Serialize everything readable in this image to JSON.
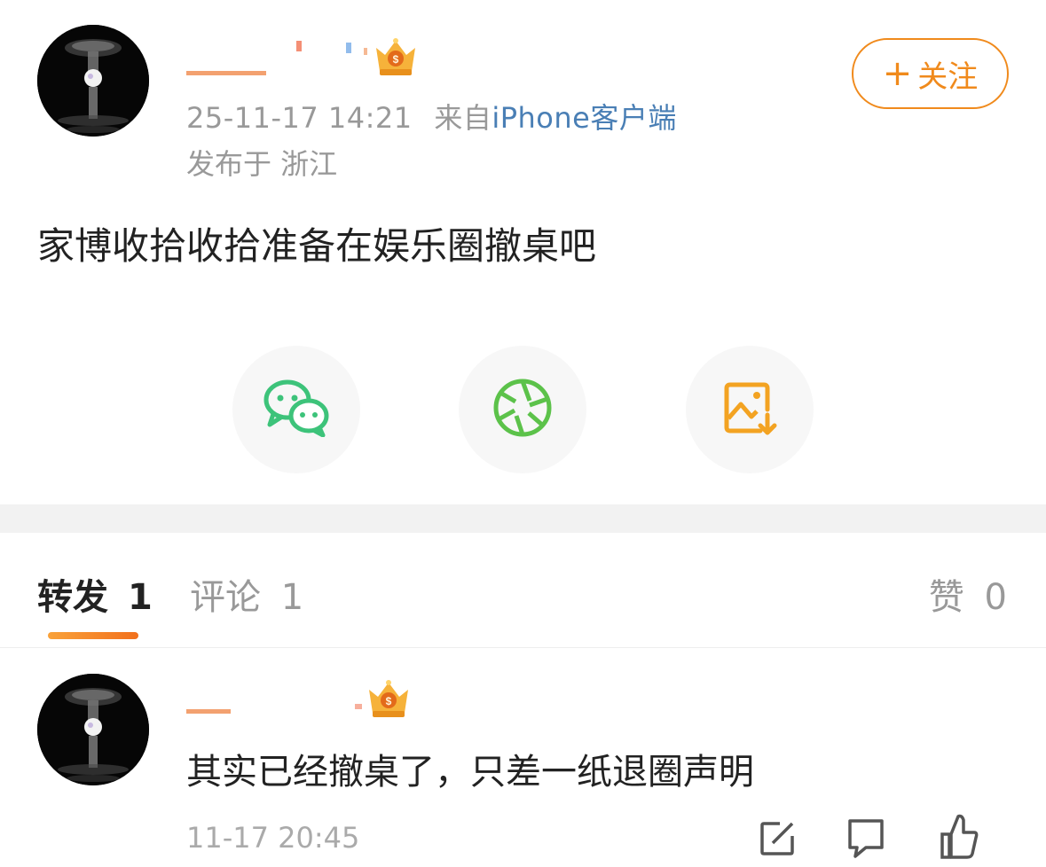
{
  "post": {
    "time": "25-11-17 14:21",
    "source_prefix": "来自",
    "source": "iPhone客户端",
    "location": "发布于 浙江",
    "follow_label": "关注",
    "follow_plus": "+",
    "body": "家博收拾收拾准备在娱乐圈撤桌吧"
  },
  "share": {
    "items": [
      {
        "icon": "wechat-icon",
        "color": "#3dc37a"
      },
      {
        "icon": "moments-icon",
        "color": "#5cc24a"
      },
      {
        "icon": "save-image-icon",
        "color": "#f3a322"
      }
    ]
  },
  "tabs": {
    "repost_label": "转发",
    "repost_count": "1",
    "comment_label": "评论",
    "comment_count": "1",
    "like_label": "赞",
    "like_count": "0"
  },
  "comment": {
    "text": "其实已经撤桌了，只差一纸退圈声明",
    "time": "11-17 20:45"
  },
  "colors": {
    "accent": "#f08a1c",
    "link": "#4a7fb5",
    "muted": "#999999",
    "text": "#222222"
  }
}
